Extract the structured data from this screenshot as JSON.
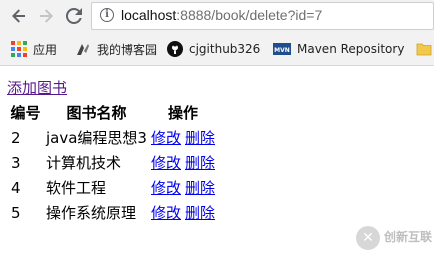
{
  "browser": {
    "url_host": "localhost",
    "url_rest": ":8888/book/delete?id=7"
  },
  "bookmarks": [
    {
      "label": "应用",
      "icon": "apps-grid-icon"
    },
    {
      "label": "我的博客园",
      "icon": "cnblogs-icon"
    },
    {
      "label": "cjgithub326",
      "icon": "github-icon"
    },
    {
      "label": "Maven Repository",
      "icon": "maven-icon"
    }
  ],
  "page": {
    "add_link": "添加图书",
    "headers": [
      "编号",
      "图书名称",
      "操作"
    ],
    "rows": [
      {
        "id": "2",
        "name": "java编程思想3",
        "edit": "修改",
        "delete": "删除"
      },
      {
        "id": "3",
        "name": "计算机技术",
        "edit": "修改",
        "delete": "删除"
      },
      {
        "id": "4",
        "name": "软件工程",
        "edit": "修改",
        "delete": "删除"
      },
      {
        "id": "5",
        "name": "操作系统原理",
        "edit": "修改",
        "delete": "删除"
      }
    ]
  },
  "watermark": {
    "mark": "✕",
    "text": "创新互联"
  }
}
